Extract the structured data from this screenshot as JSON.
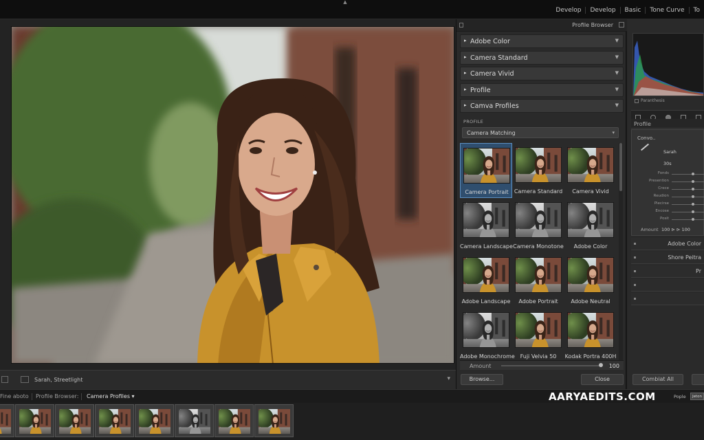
{
  "modules": [
    "Develop",
    "Develop",
    "Basic",
    "Tone Curve",
    "To"
  ],
  "photo_toolbar": {
    "label": "Sarah, Streetlight"
  },
  "profile_browser": {
    "title": "Profile Browser",
    "groups": [
      {
        "label": "Adobe Color"
      },
      {
        "label": "Camera Standard"
      },
      {
        "label": "Camera Vivid"
      },
      {
        "label": "Profile"
      },
      {
        "label": "Camva Profiles"
      }
    ],
    "profile_field_label": "PROFILE",
    "profile_select_value": "Camera Matching",
    "tiles": [
      {
        "label": "Camera Portrait",
        "style": "color",
        "selected": true
      },
      {
        "label": "Camera Standard",
        "style": "color"
      },
      {
        "label": "Camera Vivid",
        "style": "color"
      },
      {
        "label": "Camera Landscape",
        "style": "bw"
      },
      {
        "label": "Camera Monotone",
        "style": "bw"
      },
      {
        "label": "Adobe Color",
        "style": "bw"
      },
      {
        "label": "Adobe Landscape",
        "style": "color"
      },
      {
        "label": "Adobe Portrait",
        "style": "color"
      },
      {
        "label": "Adobe Neutral",
        "style": "color"
      },
      {
        "label": "Adobe Monochrome",
        "style": "bw"
      },
      {
        "label": "Fuji Velvia 50",
        "style": "color"
      },
      {
        "label": "Kodak Portra 400H",
        "style": "color"
      }
    ],
    "amount_label": "Amount",
    "amount_value": "100",
    "browse_button": "Browse...",
    "close_button": "Close"
  },
  "right_panel": {
    "histogram_checkbox_label": "Paranthesis",
    "profile_header": "Profile",
    "combo_label": "Convo..",
    "subject_name": "Sarah",
    "subject_age": "30s",
    "sliders": [
      {
        "label": "Fonds",
        "value": 0.66
      },
      {
        "label": "Presention",
        "value": 0.66
      },
      {
        "label": "Crece",
        "value": 0.66
      },
      {
        "label": "Reudion",
        "value": 0.66
      },
      {
        "label": "Piecirse",
        "value": 0.66
      },
      {
        "label": "Encose",
        "value": 0.66
      },
      {
        "label": "Posit",
        "value": 0.66
      }
    ],
    "amount_label": "Amount",
    "amount_text": "100 ⊳ ⊳ 100",
    "lines": [
      "Adobe Color",
      "Shore Peitra",
      "Pr"
    ],
    "button_left": "Combiat All"
  },
  "filmstrip_nav": {
    "crumbs": [
      "Fine aboto",
      "Profile Browser:",
      "Camera Profiles ▾"
    ],
    "watermark": "AARYAEDITS.COM",
    "people_label": "Pople",
    "people_button": "Jeton"
  },
  "filmstrip": {
    "tiles": [
      "color",
      "color",
      "color",
      "color",
      "color",
      "bw",
      "color",
      "color"
    ]
  },
  "colors": {
    "selection_blue": "#5b8fc4",
    "jacket_mustard": "#c8922c",
    "panel_bg": "#2a2a2a"
  }
}
